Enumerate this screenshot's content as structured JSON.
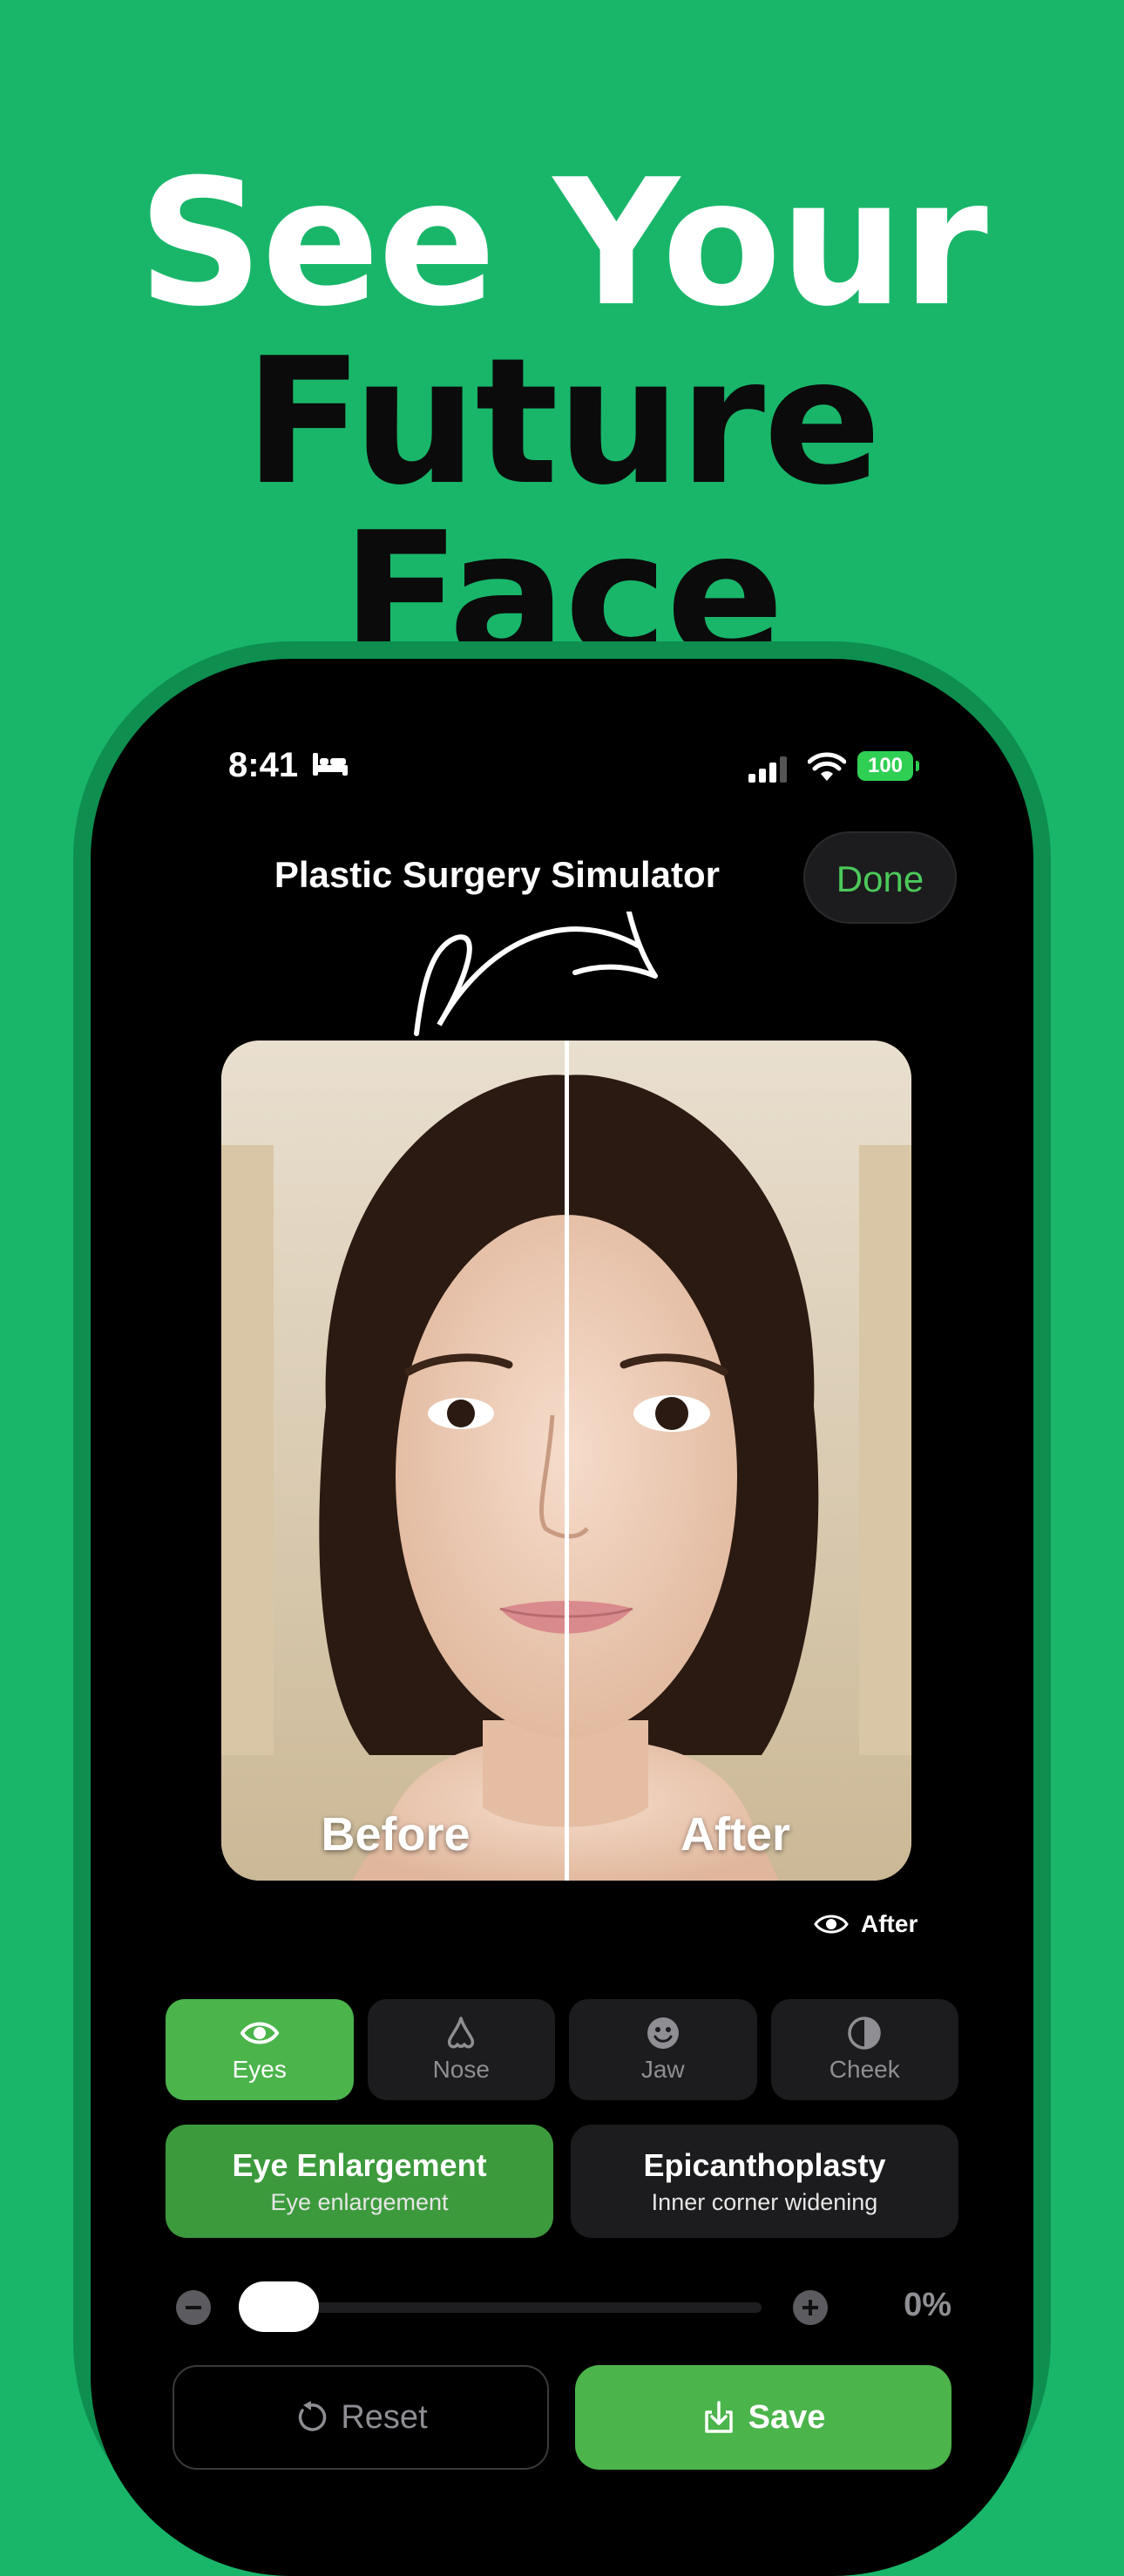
{
  "headline": {
    "line1": "See Your",
    "line2": "Future Face"
  },
  "status_bar": {
    "time": "8:41",
    "battery": "100"
  },
  "header": {
    "title": "Plastic Surgery Simulator",
    "done_label": "Done"
  },
  "photo": {
    "before_label": "Before",
    "after_label": "After"
  },
  "view_toggle": {
    "label": "After",
    "icon": "eye-icon"
  },
  "tabs": [
    {
      "label": "Eyes",
      "icon": "eye-icon",
      "active": true
    },
    {
      "label": "Nose",
      "icon": "nose-icon",
      "active": false
    },
    {
      "label": "Jaw",
      "icon": "face-smile-icon",
      "active": false
    },
    {
      "label": "Cheek",
      "icon": "half-circle-icon",
      "active": false
    }
  ],
  "options": [
    {
      "title": "Eye Enlargement",
      "subtitle": "Eye enlargement",
      "active": true
    },
    {
      "title": "Epicanthoplasty",
      "subtitle": "Inner corner widening",
      "active": false
    }
  ],
  "slider": {
    "value_label": "0%",
    "value": 0
  },
  "actions": {
    "reset_label": "Reset",
    "save_label": "Save"
  },
  "colors": {
    "background": "#19b66a",
    "accent": "#4bb44b",
    "done_text": "#4cc95a"
  }
}
